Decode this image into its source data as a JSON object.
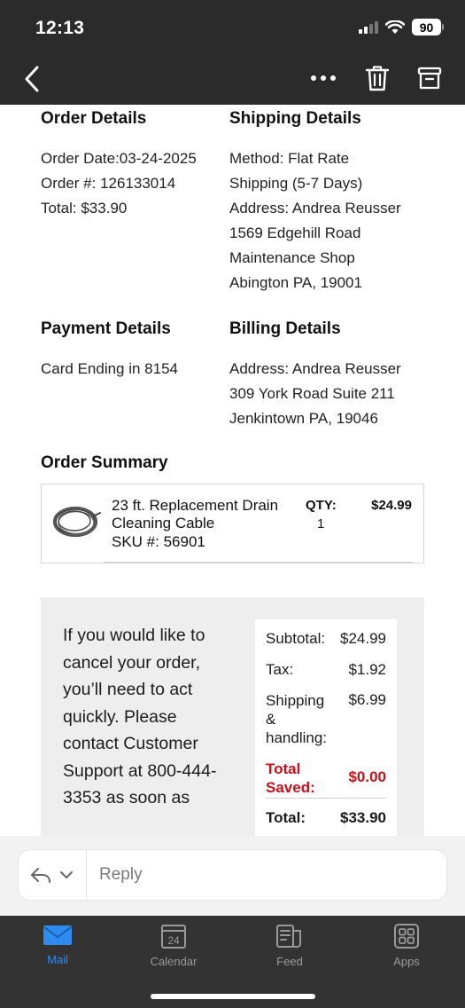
{
  "status_bar": {
    "time": "12:13",
    "battery": "90"
  },
  "toolbar": {
    "back_icon": "chevron-left-icon",
    "more_icon": "more-icon",
    "trash_icon": "trash-icon",
    "archive_icon": "archive-icon"
  },
  "email": {
    "order_details": {
      "heading": "Order Details",
      "lines": [
        "Order Date:03-24-2025",
        "Order #: 126133014",
        "Total: $33.90"
      ]
    },
    "shipping_details": {
      "heading": "Shipping Details",
      "lines": [
        "Method: Flat Rate",
        "Shipping (5-7 Days)",
        "Address: Andrea Reusser",
        "1569 Edgehill Road",
        "Maintenance Shop",
        "Abington PA, 19001"
      ]
    },
    "payment_details": {
      "heading": "Payment Details",
      "lines": [
        "Card Ending in 8154"
      ]
    },
    "billing_details": {
      "heading": "Billing Details",
      "lines": [
        "Address: Andrea Reusser",
        "309 York Road Suite 211",
        "Jenkintown PA, 19046"
      ]
    },
    "order_summary": {
      "heading": "Order Summary",
      "item": {
        "name": "23 ft. Replacement Drain Cleaning Cable",
        "sku": "SKU #: 56901",
        "qty_label": "QTY:",
        "qty": "1",
        "price": "$24.99"
      }
    },
    "cancel_notice": "If you would like to cancel your order, you’ll need to act quickly. Please contact Customer Support at 800-444-3353 as soon as",
    "totals": {
      "subtotal_label": "Subtotal:",
      "subtotal": "$24.99",
      "tax_label": "Tax:",
      "tax": "$1.92",
      "shipping_label": "Shipping & handling:",
      "shipping": "$6.99",
      "saved_label": "Total Saved:",
      "saved": "$0.00",
      "total_label": "Total:",
      "total": "$33.90"
    }
  },
  "reply_bar": {
    "placeholder": "Reply"
  },
  "tabs": [
    {
      "label": "Mail",
      "icon": "mail-icon",
      "active": true
    },
    {
      "label": "Calendar",
      "icon": "calendar-icon",
      "day": "24"
    },
    {
      "label": "Feed",
      "icon": "feed-icon"
    },
    {
      "label": "Apps",
      "icon": "apps-icon"
    }
  ],
  "colors": {
    "accent": "#2e8cf0",
    "saved_red": "#c8101a",
    "chrome": "#2b2b2b",
    "tabbar": "#333333"
  }
}
